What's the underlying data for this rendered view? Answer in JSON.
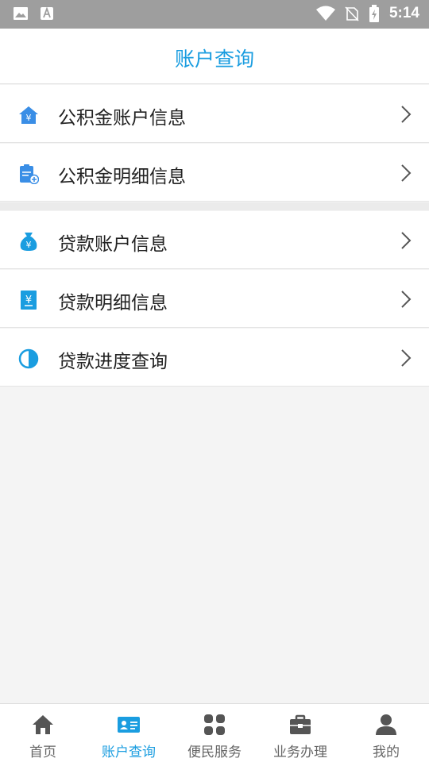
{
  "status_bar": {
    "time": "5:14",
    "icons": [
      "image-icon",
      "font-icon",
      "wifi-icon",
      "no-sim-icon",
      "battery-charging-icon"
    ]
  },
  "header": {
    "title": "账户查询"
  },
  "menu": {
    "group1": [
      {
        "label": "公积金账户信息",
        "icon": "house-yen-icon"
      },
      {
        "label": "公积金明细信息",
        "icon": "clipboard-add-icon"
      }
    ],
    "group2": [
      {
        "label": "贷款账户信息",
        "icon": "money-bag-icon"
      },
      {
        "label": "贷款明细信息",
        "icon": "document-yen-icon"
      },
      {
        "label": "贷款进度查询",
        "icon": "progress-pie-icon"
      }
    ]
  },
  "tabs": [
    {
      "label": "首页",
      "icon": "home-icon",
      "active": false
    },
    {
      "label": "账户查询",
      "icon": "id-card-icon",
      "active": true
    },
    {
      "label": "便民服务",
      "icon": "grid-icon",
      "active": false
    },
    {
      "label": "业务办理",
      "icon": "briefcase-icon",
      "active": false
    },
    {
      "label": "我的",
      "icon": "person-icon",
      "active": false
    }
  ],
  "colors": {
    "accent": "#1a9de0",
    "icon_blue": "#3a8ee6",
    "status_bar": "#9e9e9e"
  }
}
